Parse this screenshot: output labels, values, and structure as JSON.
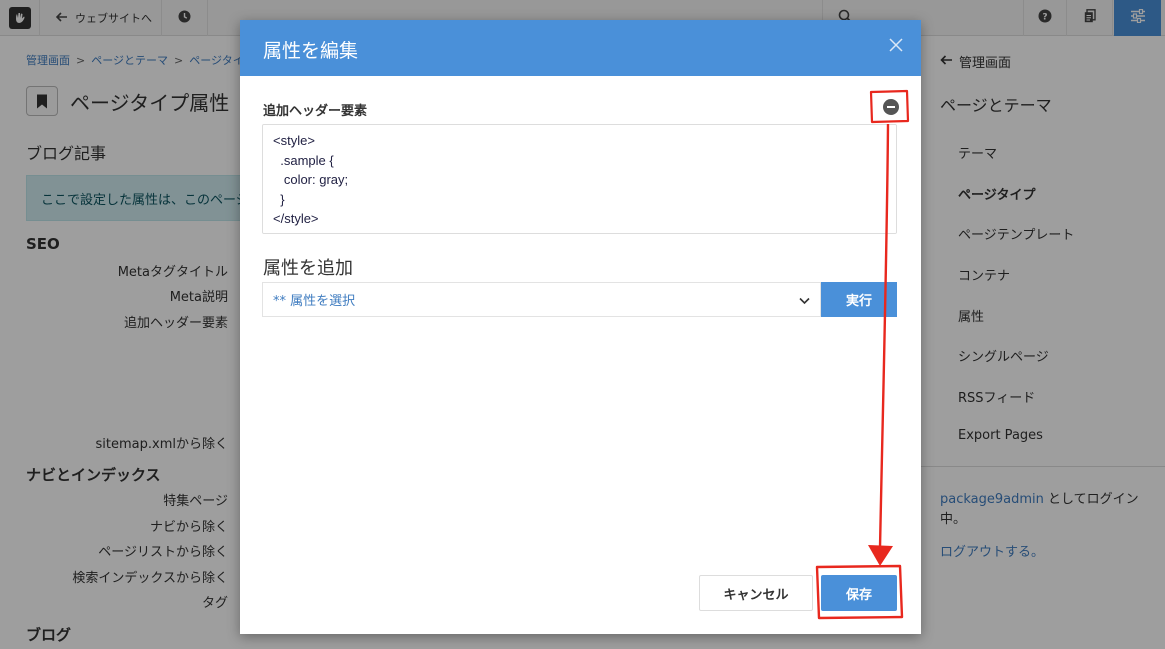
{
  "toolbar": {
    "back_label": "ウェブサイトへ",
    "icons": [
      "concrete-logo-icon",
      "arrow-left-icon",
      "clock-icon",
      "search-icon",
      "help-icon",
      "pages-icon",
      "sliders-icon"
    ]
  },
  "background": {
    "breadcrumb": [
      "管理画面",
      "ページとテーマ",
      "ページタイプ"
    ],
    "page_title": "ページタイプ属性",
    "subheading": "ブログ記事",
    "alert": "ここで設定した属性は、このページ",
    "sections": {
      "seo": "SEO",
      "nav": "ナビとインデックス",
      "blog": "ブログ"
    },
    "labels": {
      "meta_title": "Metaタグタイトル",
      "meta_desc": "Meta説明",
      "extra_header": "追加ヘッダー要素",
      "sitemap": "sitemap.xmlから除く",
      "featured": "特集ページ",
      "exclude_nav": "ナビから除く",
      "exclude_pagelist": "ページリストから除く",
      "exclude_search": "検索インデックスから除く",
      "tags": "タグ"
    }
  },
  "sidebar": {
    "back": "管理画面",
    "heading": "ページとテーマ",
    "items": [
      {
        "label": "テーマ",
        "active": false
      },
      {
        "label": "ページタイプ",
        "active": true
      },
      {
        "label": "ページテンプレート",
        "active": false
      },
      {
        "label": "コンテナ",
        "active": false
      },
      {
        "label": "属性",
        "active": false
      },
      {
        "label": "シングルページ",
        "active": false
      },
      {
        "label": "RSSフィード",
        "active": false
      },
      {
        "label": "Export Pages",
        "active": false
      }
    ],
    "login_user": "package9admin",
    "login_suffix": " としてログイン中。",
    "logout": "ログアウトする。"
  },
  "modal": {
    "title": "属性を編集",
    "field_label": "追加ヘッダー要素",
    "code_value": "<style>\n  .sample {\n   color: gray;\n  }\n</style>",
    "add_title": "属性を追加",
    "select_value": "** 属性を選択",
    "run_label": "実行",
    "cancel_label": "キャンセル",
    "save_label": "保存"
  },
  "colors": {
    "accent": "#4a90d9",
    "annotation": "#e8281e",
    "link": "#3f7cc0"
  }
}
